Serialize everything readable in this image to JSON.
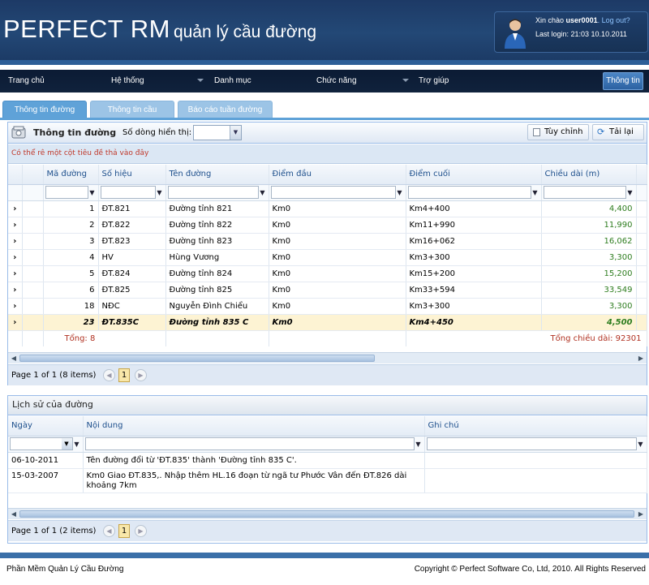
{
  "header": {
    "brand_main": "PERFECT RM",
    "brand_sub": "quản lý cầu đường",
    "greeting": "Xin chào",
    "username": "user0001",
    "logout": ". Log out?",
    "last_login": "Last login: 21:03 10.10.2011"
  },
  "nav": {
    "items": [
      "Trang chủ",
      "Hệ thống",
      "Danh mục",
      "Chức năng",
      "Trợ giúp"
    ],
    "button": "Thông tin"
  },
  "tabs": [
    "Thông tin đường",
    "Thông tin cầu",
    "Báo cáo tuần đường"
  ],
  "panel1": {
    "title": "Thông tin đường",
    "rows_label": "Số dòng hiển thị:",
    "custom_label": "Tùy chỉnh",
    "reload_label": "Tải lại",
    "group_hint": "Có thể rê một cột tiêu đề thả vào đây",
    "columns": [
      "Mã đường",
      "Số hiệu",
      "Tên đường",
      "Điểm đầu",
      "Điểm cuối",
      "Chiều dài (m)"
    ],
    "rows": [
      {
        "id": "1",
        "code": "ĐT.821",
        "name": "Đường tỉnh 821",
        "start": "Km0",
        "end": "Km4+400",
        "length": "4,400"
      },
      {
        "id": "2",
        "code": "ĐT.822",
        "name": "Đường tỉnh 822",
        "start": "Km0",
        "end": "Km11+990",
        "length": "11,990"
      },
      {
        "id": "3",
        "code": "ĐT.823",
        "name": "Đường tỉnh 823",
        "start": "Km0",
        "end": "Km16+062",
        "length": "16,062"
      },
      {
        "id": "4",
        "code": "HV",
        "name": "Hùng Vương",
        "start": "Km0",
        "end": "Km3+300",
        "length": "3,300"
      },
      {
        "id": "5",
        "code": "ĐT.824",
        "name": "Đường tỉnh 824",
        "start": "Km0",
        "end": "Km15+200",
        "length": "15,200"
      },
      {
        "id": "6",
        "code": "ĐT.825",
        "name": "Đường tỉnh 825",
        "start": "Km0",
        "end": "Km33+594",
        "length": "33,549"
      },
      {
        "id": "18",
        "code": "NĐC",
        "name": "Nguyễn Đình Chiểu",
        "start": "Km0",
        "end": "Km3+300",
        "length": "3,300"
      },
      {
        "id": "23",
        "code": "ĐT.835C",
        "name": "Đường tỉnh 835 C",
        "start": "Km0",
        "end": "Km4+450",
        "length": "4,500"
      }
    ],
    "total_label": "Tổng: 8",
    "total_length": "Tổng chiều dài: 92301",
    "pager_text": "Page 1 of 1 (8 items)",
    "current_page": "1"
  },
  "panel2": {
    "title": "Lịch sử của đường",
    "columns": [
      "Ngày",
      "Nội dung",
      "Ghi chú"
    ],
    "rows": [
      {
        "date": "06-10-2011",
        "content": "Tên đường đổi từ 'ĐT.835' thành 'Đường tỉnh 835 C'.",
        "note": ""
      },
      {
        "date": "15-03-2007",
        "content_line1": "Km0 Giao ĐT.835,. Nhập thêm HL.16 đoạn từ ngã tư Phước Vân đến ĐT.826 dài",
        "content_line2": "khoảng 7km",
        "note": ""
      }
    ],
    "pager_text": "Page 1 of 1 (2 items)",
    "current_page": "1"
  },
  "footer": {
    "left": "Phần Mềm Quản Lý Cầu Đường",
    "right": "Copyright © Perfect Software Co, Ltd, 2010. All Rights Reserved"
  },
  "colors": {
    "header_bg": "#1d3a66",
    "tab_active": "#5fa2d8",
    "selected_row": "#fdf3d3",
    "length_green": "#2e7d1f"
  }
}
